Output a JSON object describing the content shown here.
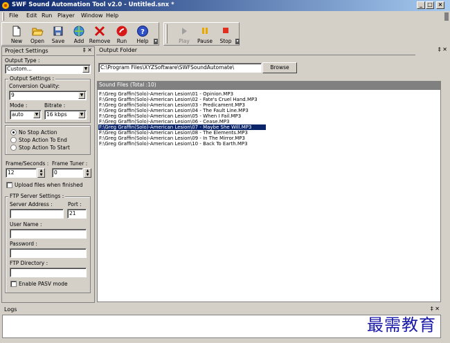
{
  "window": {
    "title": "SWF Sound Automation Tool v2.0 - Untitled.snx *"
  },
  "menu": [
    {
      "label": "File"
    },
    {
      "label": "Edit"
    },
    {
      "label": "Run"
    },
    {
      "label": "Player"
    },
    {
      "label": "Window"
    },
    {
      "label": "Help"
    }
  ],
  "toolbar": {
    "new": "New",
    "open": "Open",
    "save": "Save",
    "add": "Add",
    "remove": "Remove",
    "run": "Run",
    "help": "Help",
    "play": "Play",
    "pause": "Pause",
    "stop": "Stop"
  },
  "project_settings": {
    "title": "Project Settings",
    "close": "✕",
    "pin": "‡",
    "output_type_label": "Output Type :",
    "output_type_value": "Custom...",
    "output_settings_label": "Output Settings :",
    "conversion_quality_label": "Conversion Quality:",
    "conversion_quality_value": "9",
    "mode_label": "Mode :",
    "mode_value": "auto",
    "bitrate_label": "Bitrate :",
    "bitrate_value": "16 kbps",
    "radio_no_stop": "No Stop Action",
    "radio_stop_end": "Stop Action To End",
    "radio_stop_start": "Stop Action To Start",
    "frame_seconds_label": "Frame/Seconds :",
    "frame_seconds_value": "12",
    "frame_tuner_label": "Frame Tuner :",
    "frame_tuner_value": "0",
    "upload_label": "Upload files when finished",
    "ftp_label": "FTP Server Settings :",
    "server_address_label": "Server Address :",
    "server_address_value": "",
    "port_label": "Port :",
    "port_value": "21",
    "user_name_label": "User Name :",
    "user_name_value": "",
    "password_label": "Password :",
    "password_value": "",
    "ftp_directory_label": "FTP Directory :",
    "ftp_directory_value": "",
    "pasv_label": "Enable PASV mode"
  },
  "output_folder": {
    "title": "Output Folder",
    "path": "C:\\Program Files\\XYZSoftware\\SWFSoundAutomate\\",
    "browse": "Browse",
    "pin": "‡",
    "close": "✕"
  },
  "sound_files": {
    "header": "Sound Files (Total :10)",
    "files": [
      "F:\\Greg Graffin(Solo)-American Lesion\\01 - Opinion.MP3",
      "F:\\Greg Graffin(Solo)-American Lesion\\02 - Fate's Cruel Hand.MP3",
      "F:\\Greg Graffin(Solo)-American Lesion\\03 - Predicament.MP3",
      "F:\\Greg Graffin(Solo)-American Lesion\\04 - The Fault Line.MP3",
      "F:\\Greg Graffin(Solo)-American Lesion\\05 - When I Fail.MP3",
      "F:\\Greg Graffin(Solo)-American Lesion\\06 - Cease.MP3",
      "F:\\Greg Graffin(Solo)-American Lesion\\07 - Maybe She Will.MP3",
      "F:\\Greg Graffin(Solo)-American Lesion\\08 - The Elements.MP3",
      "F:\\Greg Graffin(Solo)-American Lesion\\09 - In The Mirror.MP3",
      "F:\\Greg Graffin(Solo)-American Lesion\\10 - Back To Earth.MP3"
    ],
    "selected_index": 6
  },
  "logs": {
    "title": "Logs",
    "pin": "‡",
    "close": "✕"
  },
  "watermark": "最需教育"
}
